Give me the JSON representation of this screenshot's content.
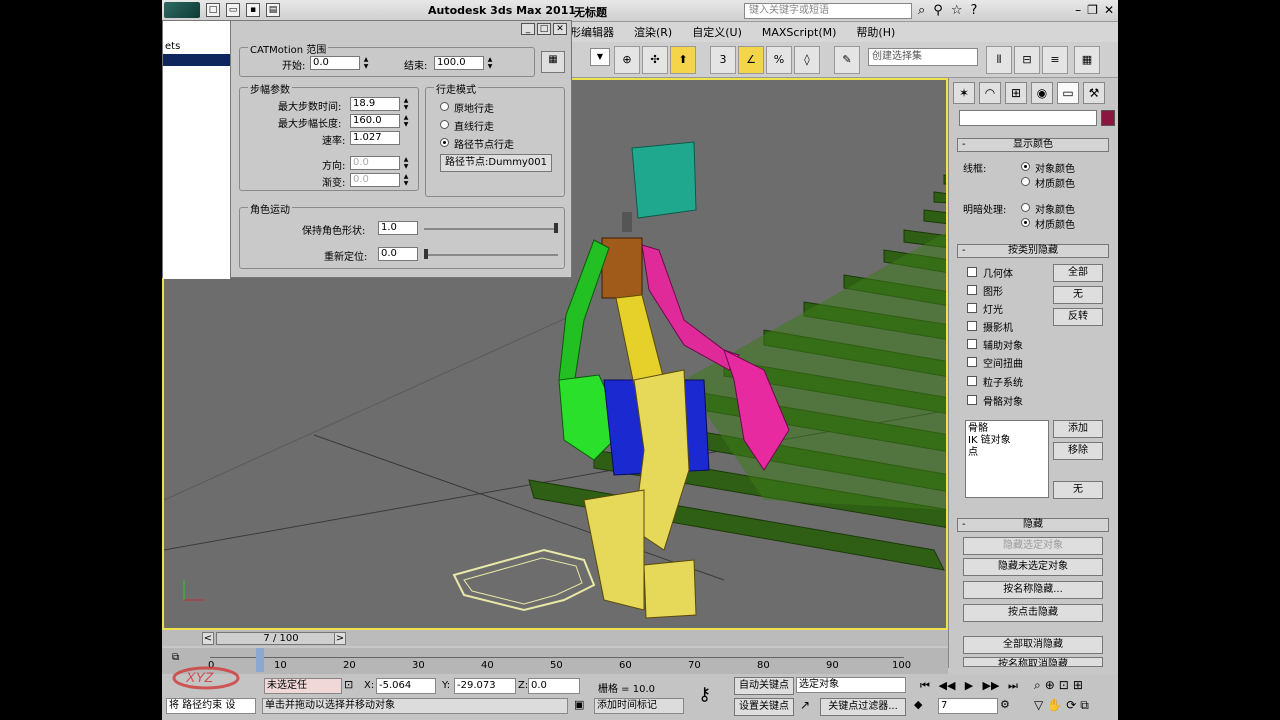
{
  "titlebar": {
    "app_title": "Autodesk 3ds Max  2011",
    "doc_title": "无标题",
    "search_placeholder": "键入关键字或短语"
  },
  "menus": [
    "形编辑器",
    "渲染(R)",
    "自定义(U)",
    "MAXScript(M)",
    "帮助(H)"
  ],
  "toolbar": {
    "selection_set_placeholder": "创建选择集",
    "snap_label": "3",
    "percent_label": "%"
  },
  "panel": {
    "left_label": "ets",
    "range_group": "CATMotion 范围",
    "start_label": "开始:",
    "start_value": "0.0",
    "end_label": "结束:",
    "end_value": "100.0",
    "stride_group": "步幅参数",
    "max_step_time_label": "最大步数时间:",
    "max_step_time_value": "18.9",
    "max_step_length_label": "最大步幅长度:",
    "max_step_length_value": "160.0",
    "speed_label": "速率:",
    "speed_value": "1.027",
    "direction_label": "方向:",
    "direction_value": "0.0",
    "gradient_label": "渐变:",
    "gradient_value": "0.0",
    "walk_mode_group": "行走模式",
    "walk_in_place": "原地行走",
    "walk_straight": "直线行走",
    "walk_path": "路径节点行走",
    "path_node_button": "路径节点:Dummy001",
    "char_motion_group": "角色运动",
    "keep_shape_label": "保持角色形状:",
    "keep_shape_value": "1.0",
    "reposition_label": "重新定位:",
    "reposition_value": "0.0"
  },
  "command_panel": {
    "display_color": "显示颜色",
    "wireframe_label": "线框:",
    "shaded_label": "明暗处理:",
    "object_color": "对象颜色",
    "material_color": "材质颜色",
    "hide_by_category": "按类别隐藏",
    "categories": [
      "几何体",
      "图形",
      "灯光",
      "摄影机",
      "辅助对象",
      "空间扭曲",
      "粒子系统",
      "骨骼对象"
    ],
    "all_button": "全部",
    "none_button": "无",
    "invert_button": "反转",
    "list_items": [
      "骨骼",
      "IK 链对象",
      "点"
    ],
    "add_button": "添加",
    "remove_button": "移除",
    "none_button2": "无",
    "hide": "隐藏",
    "hide_selected": "隐藏选定对象",
    "hide_unselected": "隐藏未选定对象",
    "hide_by_name": "按名称隐藏...",
    "hide_by_hit": "按点击隐藏",
    "unhide_all": "全部取消隐藏",
    "unhide_by_name": "按名称取消隐藏"
  },
  "timeline": {
    "frame_display": "7 / 100",
    "ticks": [
      "0",
      "10",
      "20",
      "30",
      "40",
      "50",
      "60",
      "70",
      "80",
      "90",
      "100"
    ]
  },
  "status": {
    "selection_text": "未选定任",
    "x_label": "X:",
    "x_value": "-5.064",
    "y_label": "Y:",
    "y_value": "-29.073",
    "z_label": "Z:",
    "z_value": "0.0",
    "grid_label": "栅格 = 10.0",
    "prompt_left": "将 路径约束 设",
    "prompt": "单击并拖动以选择并移动对象",
    "add_time_tag": "添加时间标记",
    "auto_key": "自动关键点",
    "set_key": "设置关键点",
    "key_filter_dd": "选定对象",
    "key_filters": "关键点过滤器...",
    "frame_value": "7"
  }
}
